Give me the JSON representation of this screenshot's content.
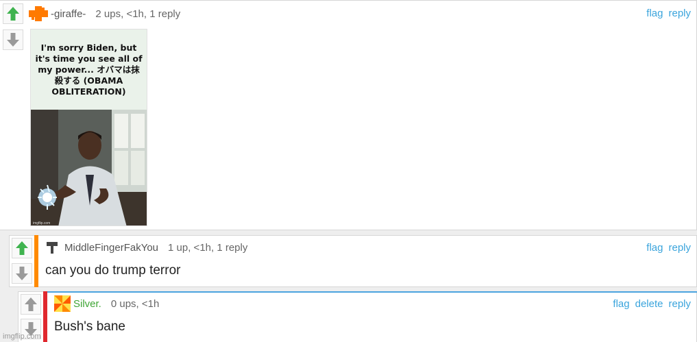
{
  "comments": [
    {
      "username": "-giraffe-",
      "meta": "2 ups, <1h, 1 reply",
      "actions": [
        "flag",
        "reply"
      ],
      "avatar_icon": "orange-plus-icon",
      "image": {
        "caption": "I'm sorry Biden, but it's time you see all of my power... オバマは抹殺する (OBAMA OBLITERATION)",
        "watermark": "imgflip.com"
      }
    },
    {
      "username": "MiddleFingerFakYou",
      "meta": "1 up, <1h, 1 reply",
      "actions": [
        "flag",
        "reply"
      ],
      "avatar_icon": "hammer-icon",
      "text": "can you do trump terror",
      "accent": "#ff8a00"
    },
    {
      "username": "Silver.",
      "meta": "0 ups, <1h",
      "actions": [
        "flag",
        "delete",
        "reply"
      ],
      "avatar_icon": "pinwheel-icon",
      "text": "Bush's bane",
      "accent": "#e0282e",
      "username_color": "#3fa535"
    }
  ],
  "site_watermark": "imgflip.com",
  "colors": {
    "upvote": "#3fb34f",
    "downvote": "#9a9a9a",
    "link": "#3aa4dc"
  }
}
